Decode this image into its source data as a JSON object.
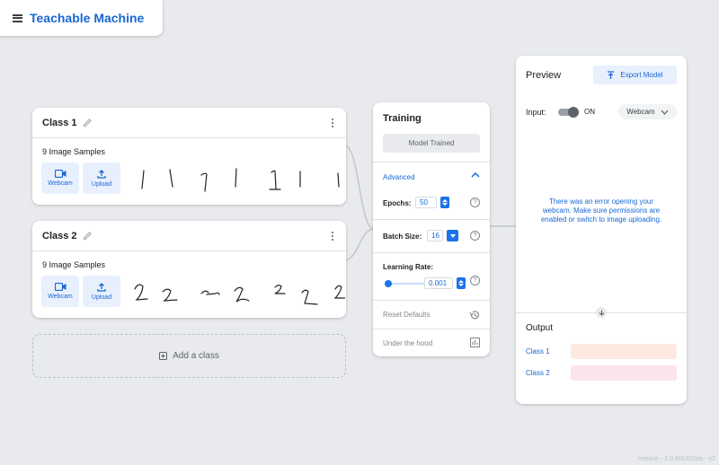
{
  "app": {
    "title": "Teachable Machine",
    "menu_icon": "menu-icon"
  },
  "classes": [
    {
      "name": "Class 1",
      "samples_label": "9 Image Samples",
      "webcam_label": "Webcam",
      "upload_label": "Upload"
    },
    {
      "name": "Class 2",
      "samples_label": "9 Image Samples",
      "webcam_label": "Webcam",
      "upload_label": "Upload"
    }
  ],
  "add_class": {
    "label": "Add a class",
    "icon": "add-box-icon"
  },
  "training": {
    "title": "Training",
    "train_button": "Model Trained",
    "advanced_label": "Advanced",
    "epochs_label": "Epochs:",
    "epochs_value": "50",
    "batch_label": "Batch Size:",
    "batch_value": "16",
    "lr_label": "Learning Rate:",
    "lr_value": "0.001",
    "lr_slider_fraction": 0.02,
    "help_glyph": "?",
    "reset_label": "Reset Defaults",
    "under_hood_label": "Under the hood"
  },
  "preview": {
    "title": "Preview",
    "export_label": "Export Model",
    "input_label": "Input:",
    "toggle_state": "ON",
    "source_label": "Webcam",
    "error_message": "There was an error opening your webcam. Make sure permissions are enabled or switch to image uploading.",
    "output_label": "Output",
    "outputs": [
      {
        "name": "Class 1",
        "color": "#fde9df"
      },
      {
        "name": "Class 2",
        "color": "#fce4ec"
      }
    ]
  },
  "colors": {
    "accent": "#1967d2",
    "primary_button": "#1a73e8",
    "background": "#e8eaed"
  },
  "version": "release - 2.0.9#b352eb - e2"
}
